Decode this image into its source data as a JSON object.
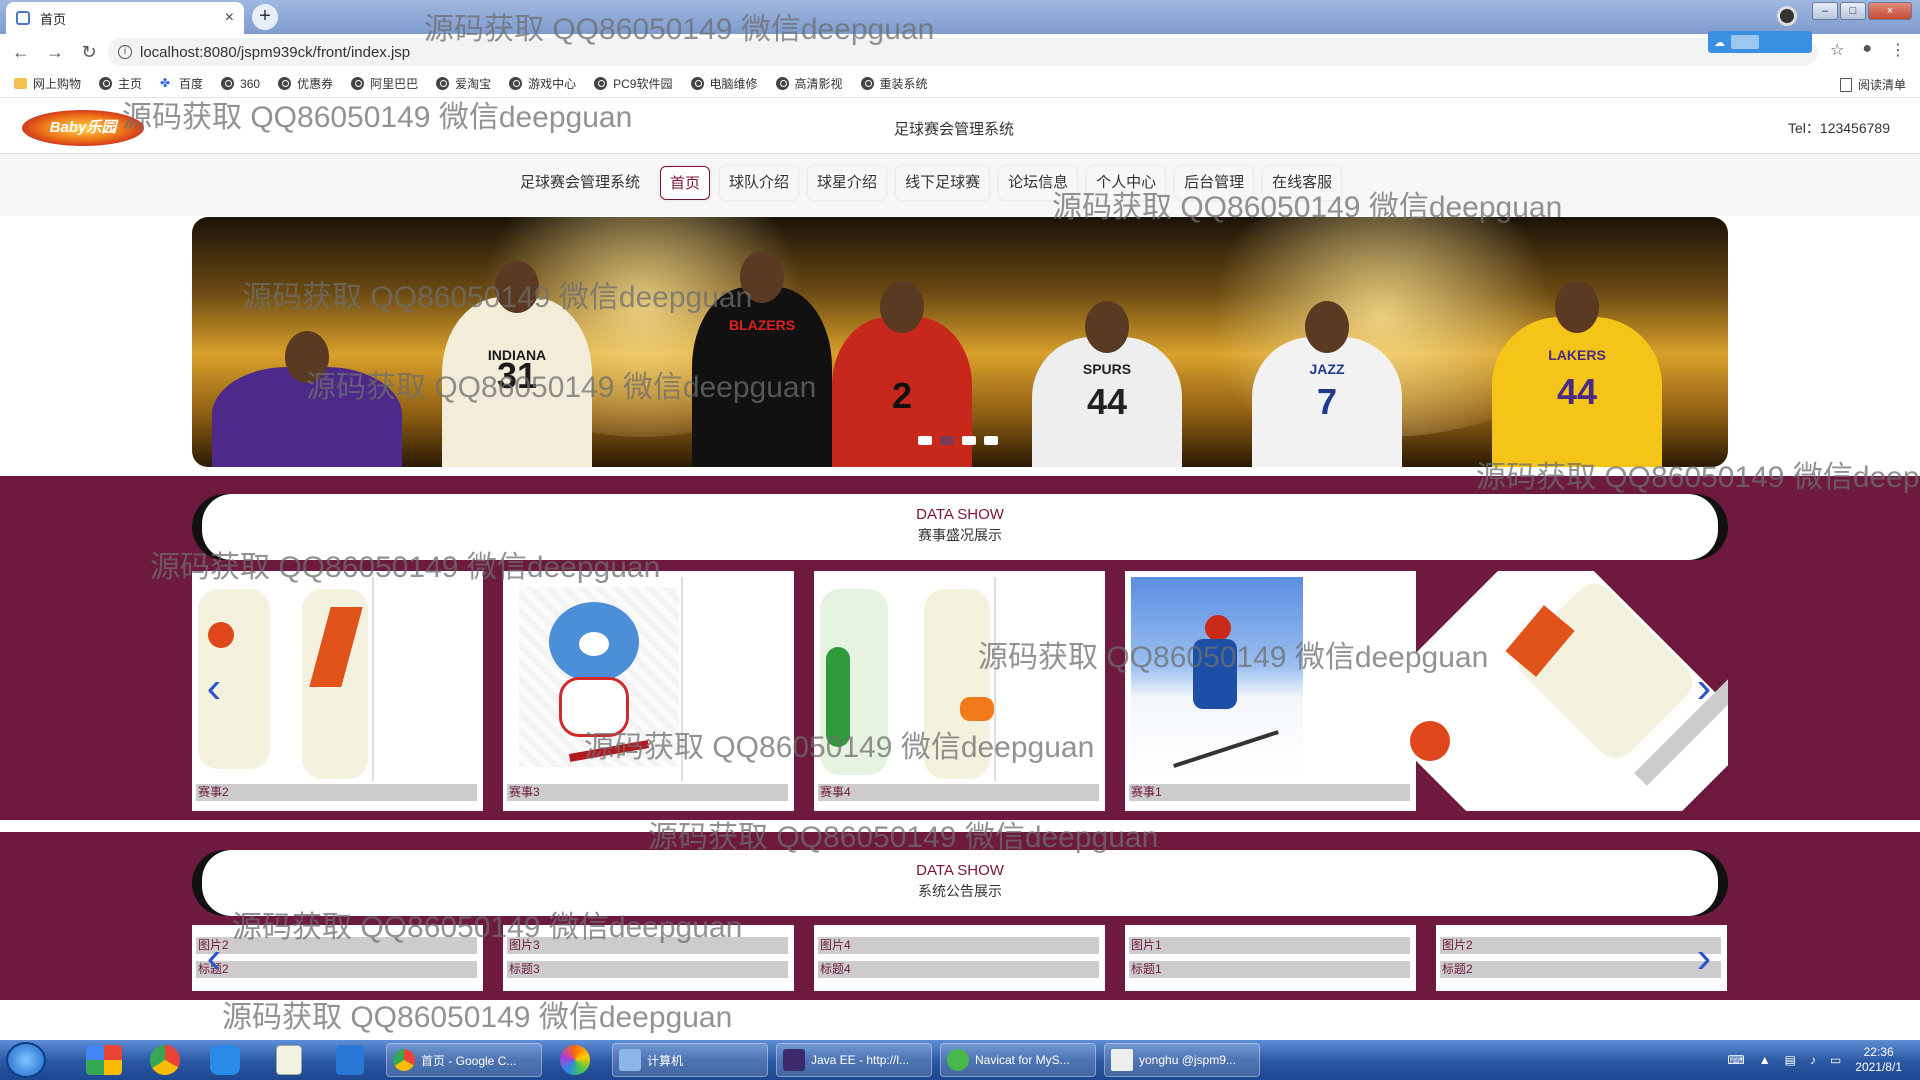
{
  "browser": {
    "tab_title": "首页",
    "url": "localhost:8080/jspm939ck/front/index.jsp",
    "bookmarks": [
      "网上购物",
      "主页",
      "百度",
      "360",
      "优惠券",
      "阿里巴巴",
      "爱淘宝",
      "游戏中心",
      "PC9软件园",
      "电脑维修",
      "高清影视",
      "重装系统"
    ],
    "reading_list": "阅读清单"
  },
  "header": {
    "logo_text": "Baby乐园",
    "site_title": "足球赛会管理系统",
    "tel": "Tel：123456789"
  },
  "nav": {
    "brand": "足球赛会管理系统",
    "items": [
      "首页",
      "球队介绍",
      "球星介绍",
      "线下足球赛",
      "论坛信息",
      "个人中心",
      "后台管理",
      "在线客服"
    ]
  },
  "banner": {
    "player_numbers": [
      "31",
      "2",
      "44",
      "7",
      "44"
    ],
    "jersey_names": [
      "INDIANA",
      "BLAZERS",
      "SPURS",
      "JAZZ",
      "LAKERS"
    ],
    "slide_count": 4,
    "active_slide": 1
  },
  "section1": {
    "title_en": "DATA SHOW",
    "title_cn": "赛事盛况展示",
    "cards": [
      "赛事2",
      "赛事3",
      "赛事4",
      "赛事1"
    ]
  },
  "section2": {
    "title_en": "DATA SHOW",
    "title_cn": "系统公告展示",
    "cards": [
      {
        "img": "图片2",
        "title": "标题2"
      },
      {
        "img": "图片3",
        "title": "标题3"
      },
      {
        "img": "图片4",
        "title": "标题4"
      },
      {
        "img": "图片1",
        "title": "标题1"
      },
      {
        "img": "图片2",
        "title": "标题2"
      }
    ]
  },
  "watermark": "源码获取 QQ86050149 微信deepguan",
  "taskbar": {
    "apps": [
      "首页 - Google C...",
      "计算机",
      "Java EE - http://l...",
      "Navicat for MyS...",
      "yonghu @jspm9..."
    ],
    "time": "22:36",
    "date": "2021/8/1"
  }
}
